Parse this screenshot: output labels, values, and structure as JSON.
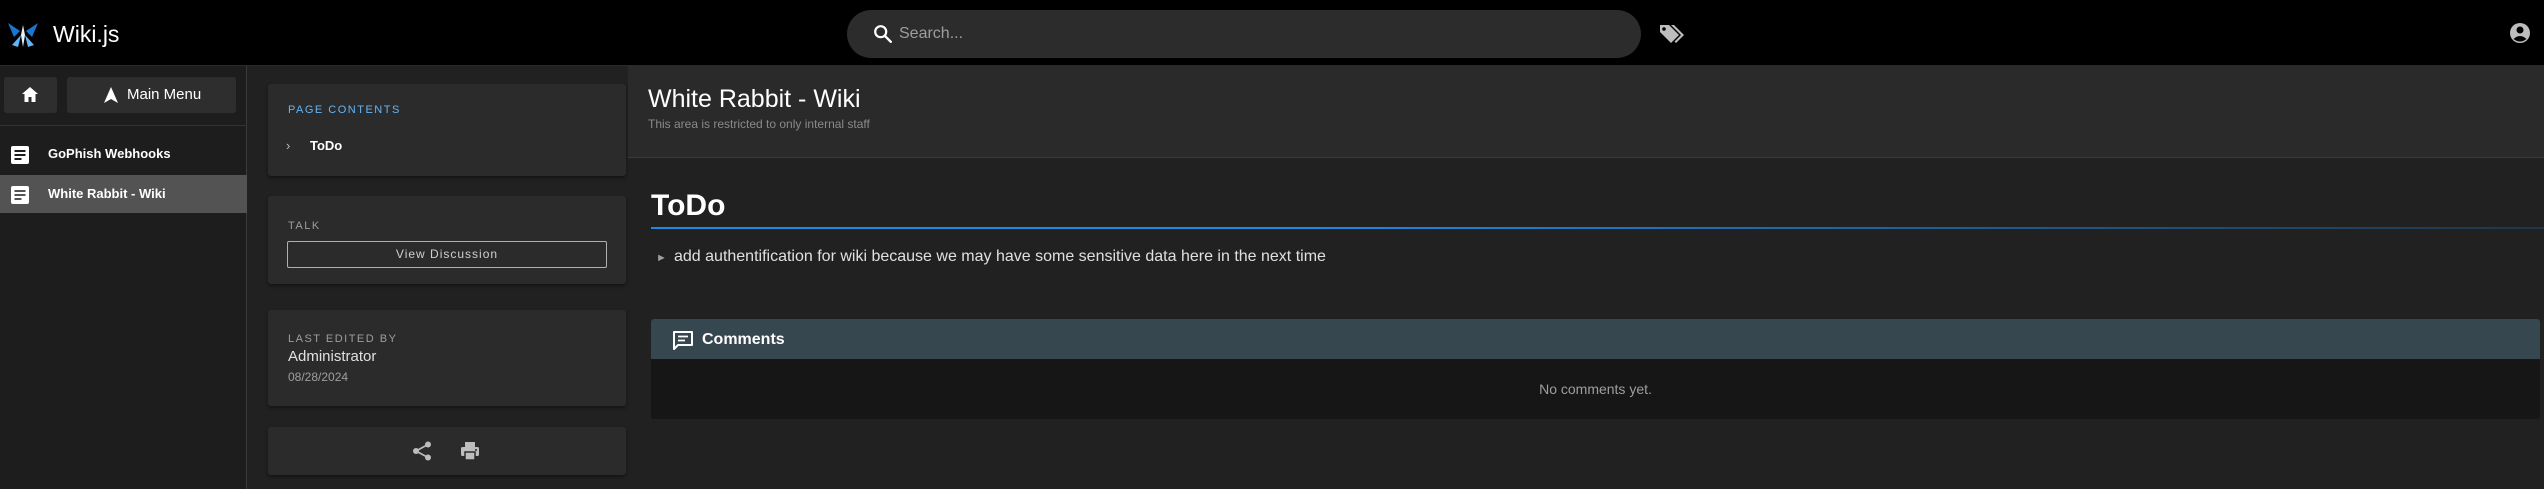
{
  "app": {
    "title": "Wiki.js"
  },
  "search": {
    "placeholder": "Search..."
  },
  "nav": {
    "main_menu_label": "Main Menu",
    "items": [
      {
        "label": "GoPhish Webhooks",
        "active": false
      },
      {
        "label": "White Rabbit - Wiki",
        "active": true
      }
    ]
  },
  "toc": {
    "caption": "PAGE CONTENTS",
    "items": [
      "ToDo"
    ]
  },
  "talk": {
    "caption": "TALK",
    "button_label": "View Discussion"
  },
  "last_edited": {
    "caption": "LAST EDITED BY",
    "name": "Administrator",
    "date": "08/28/2024"
  },
  "page": {
    "title": "White Rabbit - Wiki",
    "description": "This area is restricted to only internal staff",
    "heading": "ToDo",
    "bullet_marker": "►",
    "paragraph": "add authentification for wiki because we may have some sensitive data here in the next time"
  },
  "comments": {
    "header": "Comments",
    "empty_text": "No comments yet."
  },
  "colors": {
    "accent": "#1e88e5",
    "toc_caption": "#64b5f6",
    "comments_header_bg": "#37474f",
    "topbar_bg": "#000000",
    "nav_active_bg": "#535353"
  },
  "icons": [
    "wiki-logo-icon",
    "search-icon",
    "tags-icon",
    "account-icon",
    "home-icon",
    "navigation-arrow-icon",
    "page-icon",
    "share-icon",
    "print-icon",
    "comment-icon"
  ]
}
